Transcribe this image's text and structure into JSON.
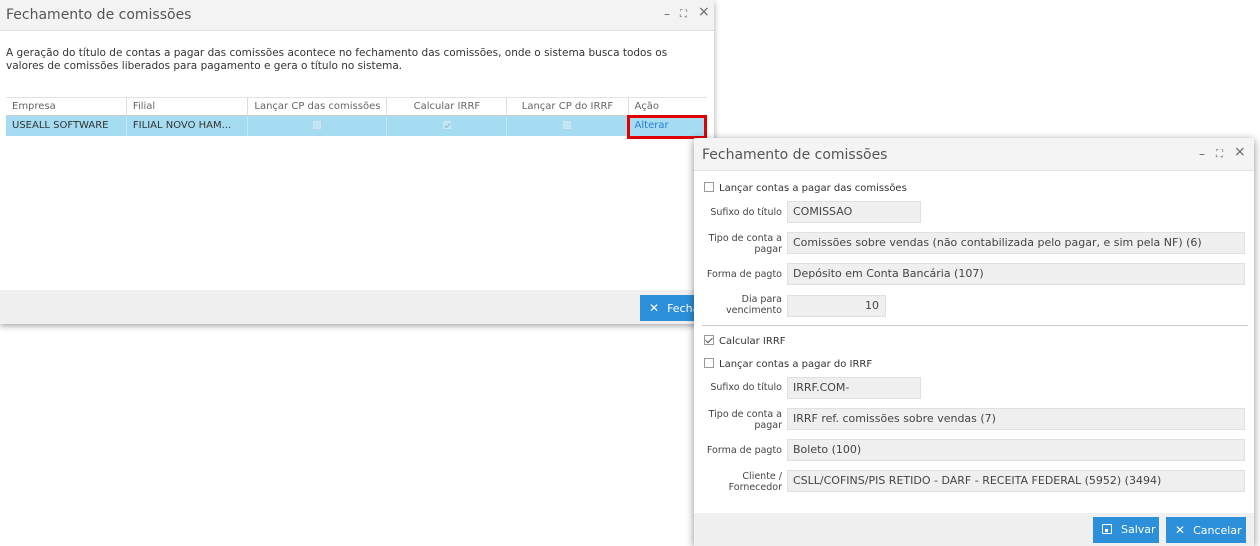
{
  "window1": {
    "title": "Fechamento de comissões",
    "controls": {
      "minimize": "–",
      "maximize": "⛶",
      "close": "×"
    },
    "description": "A geração do título de contas a pagar das comissões acontece no fechamento das comissões, onde o sistema busca todos os valores de comissões liberados para pagamento e gera o título no sistema.",
    "table": {
      "headers": [
        "Empresa",
        "Filial",
        "Lançar CP das comissões",
        "Calcular IRRF",
        "Lançar CP do IRRF",
        "Ação"
      ],
      "rows": [
        {
          "empresa": "USEALL SOFTWARE",
          "filial": "FILIAL NOVO HAM...",
          "lancar_cp_comissoes": false,
          "calcular_irrf": true,
          "lancar_cp_irrf": false,
          "acao": "Alterar"
        }
      ]
    },
    "close_button": "Fecha"
  },
  "window2": {
    "title": "Fechamento de comissões",
    "controls": {
      "minimize": "–",
      "maximize": "⛶",
      "close": "×"
    },
    "comissoes": {
      "lancar_label": "Lançar contas a pagar das comissões",
      "lancar_checked": false,
      "sufixo_label": "Sufixo do título",
      "sufixo_value": "COMISSAO",
      "tipo_label": "Tipo de conta a pagar",
      "tipo_value": "Comissões sobre vendas    (não contabilizada pelo pagar, e sim pela NF) (6)",
      "forma_label": "Forma de pagto",
      "forma_value": "Depósito em Conta Bancária (107)",
      "dia_label": "Dia para vencimento",
      "dia_value": "10"
    },
    "irrf": {
      "calcular_label": "Calcular IRRF",
      "calcular_checked": true,
      "lancar_label": "Lançar contas a pagar do IRRF",
      "lancar_checked": false,
      "sufixo_label": "Sufixo do título",
      "sufixo_value": "IRRF.COM-",
      "tipo_label": "Tipo de conta a pagar",
      "tipo_value": "IRRF ref. comissões sobre vendas (7)",
      "forma_label": "Forma de pagto",
      "forma_value": "Boleto (100)",
      "cliente_label": "Cliente / Fornecedor",
      "cliente_value": "CSLL/COFINS/PIS RETIDO - DARF - RECEITA FEDERAL (5952) (3494)"
    },
    "buttons": {
      "save": "Salvar",
      "cancel": "Cancelar"
    }
  }
}
